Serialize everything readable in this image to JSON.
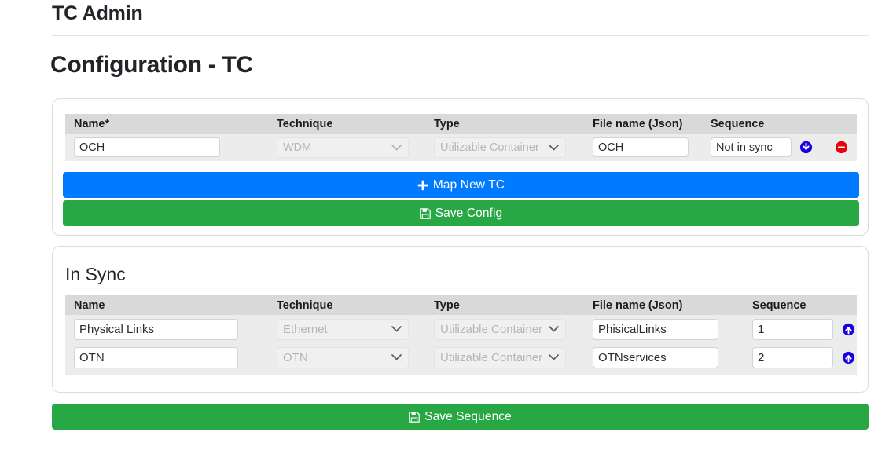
{
  "header": {
    "app_title": "TC Admin",
    "section_title": "Configuration - TC"
  },
  "config_card": {
    "columns": [
      "Name*",
      "Technique",
      "Type",
      "File name (Json)",
      "Sequence"
    ],
    "rows": [
      {
        "name": "OCH",
        "technique": "WDM",
        "type": "Utilizable Container",
        "file_name": "OCH",
        "sequence": "Not in sync"
      }
    ],
    "map_new_label": "Map New TC",
    "save_config_label": "Save Config",
    "map_new_icon": "plus-icon",
    "save_icon": "floppy-save-icon",
    "move_icon": "arrow-down-circle-icon",
    "remove_icon": "minus-circle-icon"
  },
  "insync_card": {
    "heading": "In Sync",
    "columns": [
      "Name",
      "Technique",
      "Type",
      "File name (Json)",
      "Sequence"
    ],
    "rows": [
      {
        "name": "Physical Links",
        "technique": "Ethernet",
        "type": "Utilizable Container",
        "file_name": "PhisicalLinks",
        "sequence": "1"
      },
      {
        "name": "OTN",
        "technique": "OTN",
        "type": "Utilizable Container",
        "file_name": "OTNservices",
        "sequence": "2"
      }
    ],
    "move_icon": "arrow-up-circle-icon"
  },
  "footer": {
    "save_sequence_label": "Save Sequence",
    "save_icon": "floppy-save-icon"
  },
  "colors": {
    "primary_blue": "#007bff",
    "success_green": "#28a745",
    "danger_red": "#e8000d",
    "header_gray": "#d9d9d9",
    "row_gray": "#ececec"
  }
}
